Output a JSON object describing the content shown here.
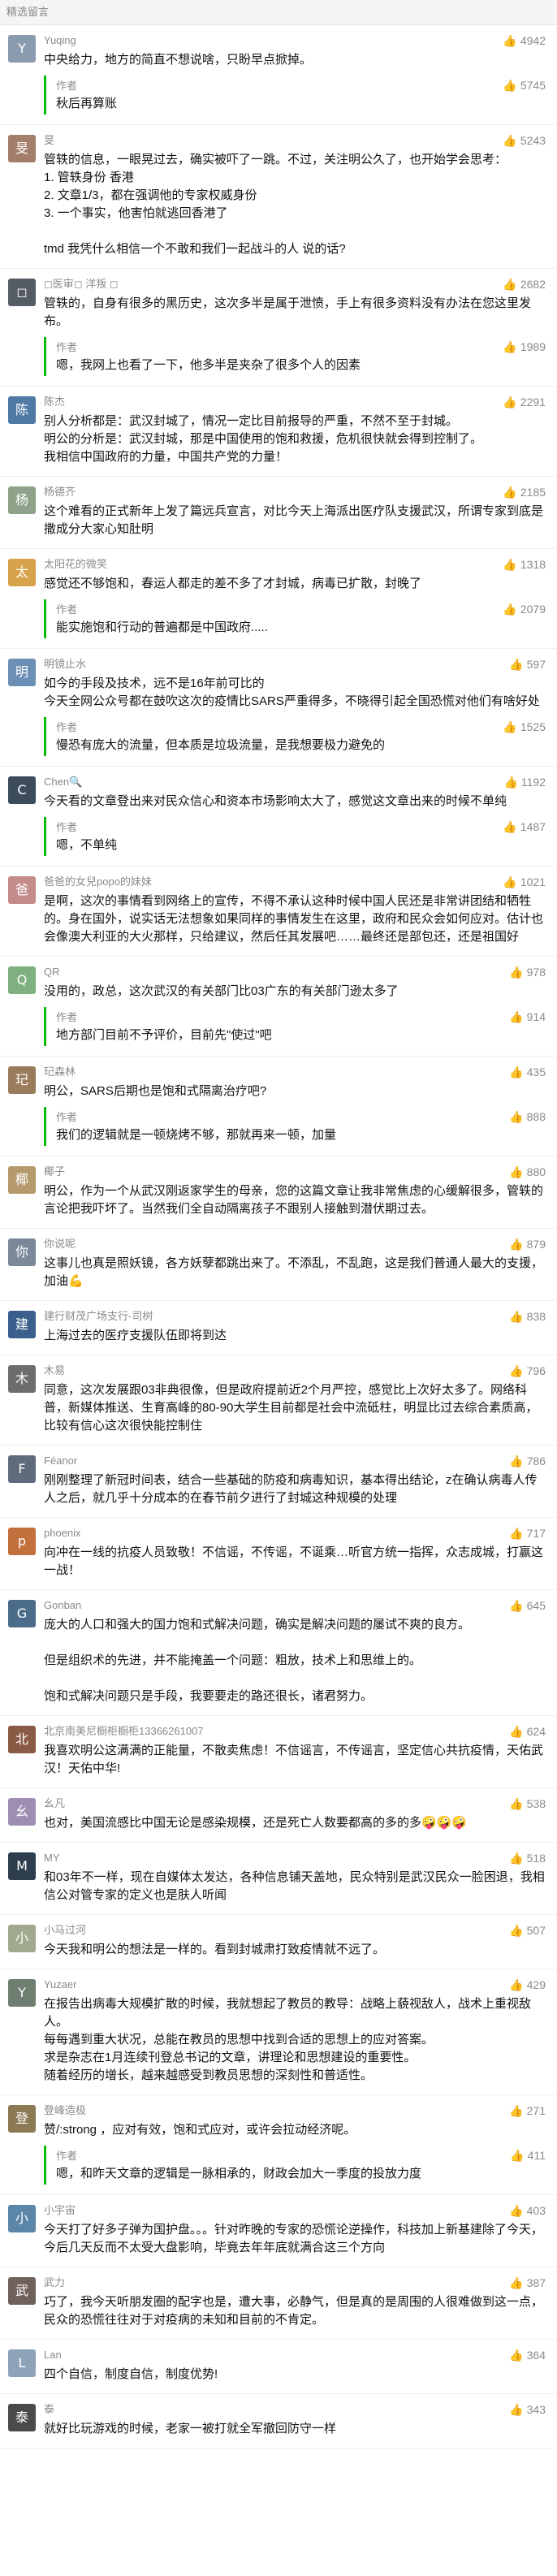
{
  "header": "精选留言",
  "thumb_icon": "👍",
  "reply_label": "作者",
  "comments": [
    {
      "nick": "Yuqing",
      "likes": "4942",
      "color": "#8a9bb0",
      "avatar": "Y",
      "text": "中央给力，地方的简直不想说啥，只盼早点掀掉。",
      "reply": "秋后再算账",
      "reply_likes": "5745"
    },
    {
      "nick": "旻",
      "likes": "5243",
      "color": "#a37e6a",
      "avatar": "旻",
      "text": "管轶的信息，一眼晃过去，确实被吓了一跳。不过，关注明公久了，也开始学会思考：\n1. 管轶身份 香港\n2. 文章1/3，都在强调他的专家权威身份\n3. 一个事实，他害怕就逃回香港了\n\ntmd 我凭什么相信一个不敢和我们一起战斗的人 说的话?",
      "reply": "",
      "reply_likes": ""
    },
    {
      "nick": "◻医审◻ 洋叛 ◻",
      "likes": "2682",
      "color": "#555c66",
      "avatar": "◻",
      "text": "管轶的，自身有很多的黑历史，这次多半是属于泄愤，手上有很多资料没有办法在您这里发布。",
      "reply": "嗯，我网上也看了一下，他多半是夹杂了很多个人的因素",
      "reply_likes": "1989"
    },
    {
      "nick": "陈杰",
      "likes": "2291",
      "color": "#4f7aa3",
      "avatar": "陈",
      "text": "别人分析都是：武汉封城了，情况一定比目前报导的严重，不然不至于封城。\n明公的分析是：武汉封城，那是中国使用的饱和救援，危机很快就会得到控制了。\n我相信中国政府的力量，中国共产党的力量！",
      "reply": "",
      "reply_likes": ""
    },
    {
      "nick": "杨德齐",
      "likes": "2185",
      "color": "#8fa38a",
      "avatar": "杨",
      "text": "这个难看的正式新年上发了篇远兵宣言，对比今天上海派出医疗队支援武汉，所谓专家到底是撒成分大家心知肚明",
      "reply": "",
      "reply_likes": ""
    },
    {
      "nick": "太阳花的微笑",
      "likes": "1318",
      "color": "#d6a24a",
      "avatar": "太",
      "text": "感觉还不够饱和，春运人都走的差不多了才封城，病毒已扩散，封晚了",
      "reply": "能实施饱和行动的普遍都是中国政府.....",
      "reply_likes": "2079"
    },
    {
      "nick": "明镜止水",
      "likes": "597",
      "color": "#6b8fb5",
      "avatar": "明",
      "text": "如今的手段及技术，远不是16年前可比的\n今天全网公众号都在鼓吹这次的疫情比SARS严重得多，不晓得引起全国恐慌对他们有啥好处",
      "reply": "慢恐有庞大的流量，但本质是垃圾流量，是我想要极力避免的",
      "reply_likes": "1525"
    },
    {
      "nick": "Chen🔍",
      "likes": "1192",
      "color": "#3d4c5c",
      "avatar": "C",
      "text": "今天看的文章登出来对民众信心和资本市场影响太大了，感觉这文章出来的时候不单纯",
      "reply": "嗯，不单纯",
      "reply_likes": "1487"
    },
    {
      "nick": "爸爸的女兒popo的妹妹",
      "likes": "1021",
      "color": "#c48b8b",
      "avatar": "爸",
      "text": "是啊，这次的事情看到网络上的宣传，不得不承认这种时候中国人民还是非常讲团结和牺牲的。身在国外，说实话无法想象如果同样的事情发生在这里，政府和民众会如何应对。估计也会像澳大利亚的大火那样，只给建议，然后任其发展吧……最终还是部包还，还是祖国好",
      "reply": "",
      "reply_likes": ""
    },
    {
      "nick": "QR",
      "likes": "978",
      "color": "#7fb07f",
      "avatar": "Q",
      "text": "没用的，政总，这次武汉的有关部门比03广东的有关部门逊太多了",
      "reply": "地方部门目前不予评价，目前先\"使过\"吧",
      "reply_likes": "914"
    },
    {
      "nick": "玘森林",
      "likes": "435",
      "color": "#9a7b5c",
      "avatar": "玘",
      "text": "明公，SARS后期也是饱和式隔离治疗吧?",
      "reply": "我们的逻辑就是一顿烧烤不够，那就再来一顿，加量",
      "reply_likes": "888"
    },
    {
      "nick": "椰子",
      "likes": "880",
      "color": "#b59a6e",
      "avatar": "椰",
      "text": "明公，作为一个从武汉刚返家学生的母亲，您的这篇文章让我非常焦虑的心缓解很多，管轶的言论把我吓坏了。当然我们全自动隔离孩子不跟别人接触到潜伏期过去。",
      "reply": "",
      "reply_likes": ""
    },
    {
      "nick": "你说呢",
      "likes": "879",
      "color": "#7a8899",
      "avatar": "你",
      "text": "这事儿也真是照妖镜，各方妖孽都跳出来了。不添乱，不乱跑，这是我们普通人最大的支援，加油💪",
      "reply": "",
      "reply_likes": ""
    },
    {
      "nick": "建行财茂广场支行-司树",
      "likes": "838",
      "color": "#3a5f8c",
      "avatar": "建",
      "text": "上海过去的医疗支援队伍即将到达",
      "reply": "",
      "reply_likes": ""
    },
    {
      "nick": "木易",
      "likes": "796",
      "color": "#6d6d6d",
      "avatar": "木",
      "text": "同意，这次发展跟03非典很像，但是政府提前近2个月严控，感觉比上次好太多了。网络科普，新媒体推送、生育高峰的80-90大学生目前都是社会中流砥柱，明显比过去综合素质高，比较有信心这次很快能控制住",
      "reply": "",
      "reply_likes": ""
    },
    {
      "nick": "Féanor",
      "likes": "786",
      "color": "#5e6b7d",
      "avatar": "F",
      "text": "刚刚整理了新冠时间表，结合一些基础的防疫和病毒知识，基本得出结论，z在确认病毒人传人之后，就几乎十分成本的在春节前夕进行了封城这种规模的处理",
      "reply": "",
      "reply_likes": ""
    },
    {
      "nick": "phoenix",
      "likes": "717",
      "color": "#c2703d",
      "avatar": "p",
      "text": "向冲在一线的抗疫人员致敬！不信谣，不传谣，不诞乘…听官方统一指挥，众志成城，打赢这一战！",
      "reply": "",
      "reply_likes": ""
    },
    {
      "nick": "Gonban",
      "likes": "645",
      "color": "#4b6b8a",
      "avatar": "G",
      "text": "庞大的人口和强大的国力饱和式解决问题，确实是解决问题的屡试不爽的良方。\n\n但是组织术的先进，并不能掩盖一个问题：粗放，技术上和思维上的。\n\n饱和式解决问题只是手段，我要要走的路还很长，诸君努力。",
      "reply": "",
      "reply_likes": ""
    },
    {
      "nick": "北京南美尼橱柜橱柜13366261007",
      "likes": "624",
      "color": "#8a5a44",
      "avatar": "北",
      "text": "我喜欢明公这满满的正能量，不散卖焦虑！不信谣言，不传谣言，坚定信心共抗疫情，天佑武汉！天佑中华!",
      "reply": "",
      "reply_likes": ""
    },
    {
      "nick": "幺凡",
      "likes": "538",
      "color": "#9e8fb2",
      "avatar": "幺",
      "text": "也对，美国流感比中国无论是感染规模，还是死亡人数要都高的多的多🤪🤪🤪",
      "reply": "",
      "reply_likes": ""
    },
    {
      "nick": "MY",
      "likes": "518",
      "color": "#2f3e4f",
      "avatar": "M",
      "text": "和03年不一样，现在自媒体太发达，各种信息铺天盖地，民众特别是武汉民众一脸困退，我相信公对管专家的定义也是肤人听闻",
      "reply": "",
      "reply_likes": ""
    },
    {
      "nick": "小马过河",
      "likes": "507",
      "color": "#a0a88e",
      "avatar": "小",
      "text": "今天我和明公的想法是一样的。看到封城肃打致疫情就不远了。",
      "reply": "",
      "reply_likes": ""
    },
    {
      "nick": "Yuzaer",
      "likes": "429",
      "color": "#6e7f72",
      "avatar": "Y",
      "text": "在报告出病毒大规模扩散的时候，我就想起了教员的教导：战略上藐视敌人，战术上重视敌人。\n每每遇到重大状况，总能在教员的思想中找到合适的思想上的应对答案。\n求是杂志在1月连续刊登总书记的文章，讲理论和思想建设的重要性。\n随着经历的增长，越来越感受到教员思想的深刻性和普适性。",
      "reply": "",
      "reply_likes": ""
    },
    {
      "nick": "登峰造极",
      "likes": "271",
      "color": "#8c7a55",
      "avatar": "登",
      "text": "赞/:strong ，应对有效，饱和式应对，或许会拉动经济呢。",
      "reply": "嗯，和昨天文章的逻辑是一脉相承的，财政会加大一季度的投放力度",
      "reply_likes": "411"
    },
    {
      "nick": "小宇宙",
      "likes": "403",
      "color": "#5b86a8",
      "avatar": "小",
      "text": "今天打了好多子弹为国护盘。。。针对昨晚的专家的恐慌论逆操作，科技加上新基建除了今天，今后几天反而不太受大盘影响，毕竟去年年底就满合这三个方向",
      "reply": "",
      "reply_likes": ""
    },
    {
      "nick": "武力",
      "likes": "387",
      "color": "#70615a",
      "avatar": "武",
      "text": "巧了，我今天听朋发圈的配字也是，遭大事，必静气，但是真的是周围的人很难做到这一点，民众的恐慌往往对于对疫病的未知和目前的不肯定。",
      "reply": "",
      "reply_likes": ""
    },
    {
      "nick": "Lan",
      "likes": "364",
      "color": "#8fa3b8",
      "avatar": "L",
      "text": "四个自信，制度自信，制度优势!",
      "reply": "",
      "reply_likes": ""
    },
    {
      "nick": "泰",
      "likes": "343",
      "color": "#4a4a4a",
      "avatar": "泰",
      "text": "就好比玩游戏的时候，老家一被打就全军撤回防守一样",
      "reply": "",
      "reply_likes": ""
    }
  ]
}
